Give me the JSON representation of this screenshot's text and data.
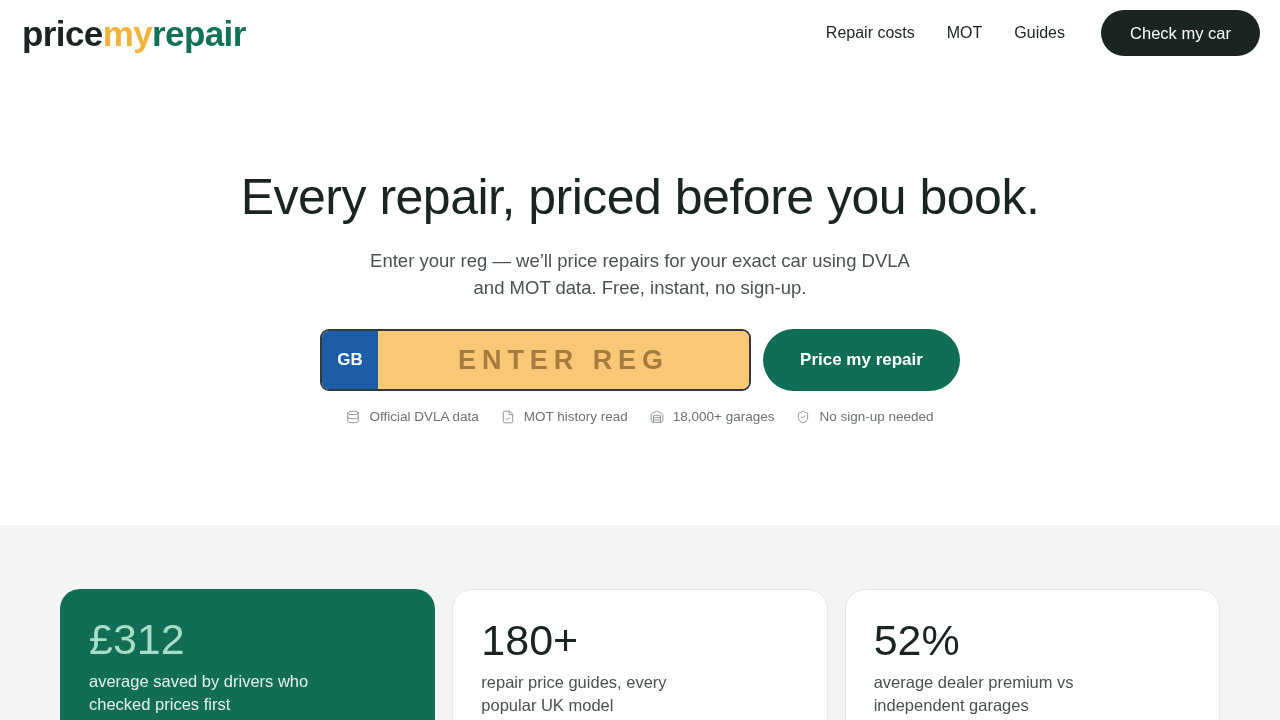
{
  "logo": [
    "price",
    "my",
    "repair"
  ],
  "nav": {
    "links": [
      "Repair costs",
      "MOT",
      "Guides"
    ],
    "cta": "Check my car"
  },
  "hero": {
    "title": "Every repair, priced before you book.",
    "subtitle": "Enter your reg — we’ll price repairs for your exact car using DVLA and MOT data. Free, instant, no sign-up.",
    "plate": {
      "country": "GB",
      "placeholder": "ENTER REG"
    },
    "button": "Price my repair",
    "trust_points": [
      {
        "kind": "database",
        "label": "Official DVLA data"
      },
      {
        "kind": "document",
        "label": "MOT history read"
      },
      {
        "kind": "garage",
        "label": "18,000+ garages"
      },
      {
        "kind": "shield",
        "label": "No sign-up needed"
      }
    ]
  },
  "stats": [
    {
      "value": "£312",
      "label": "average saved by drivers who checked prices first",
      "highlighted": true
    },
    {
      "value": "180+",
      "label": "repair price guides, every popular UK model",
      "highlighted": false
    },
    {
      "value": "52%",
      "label": "average dealer premium vs independent garages",
      "highlighted": false
    }
  ]
}
